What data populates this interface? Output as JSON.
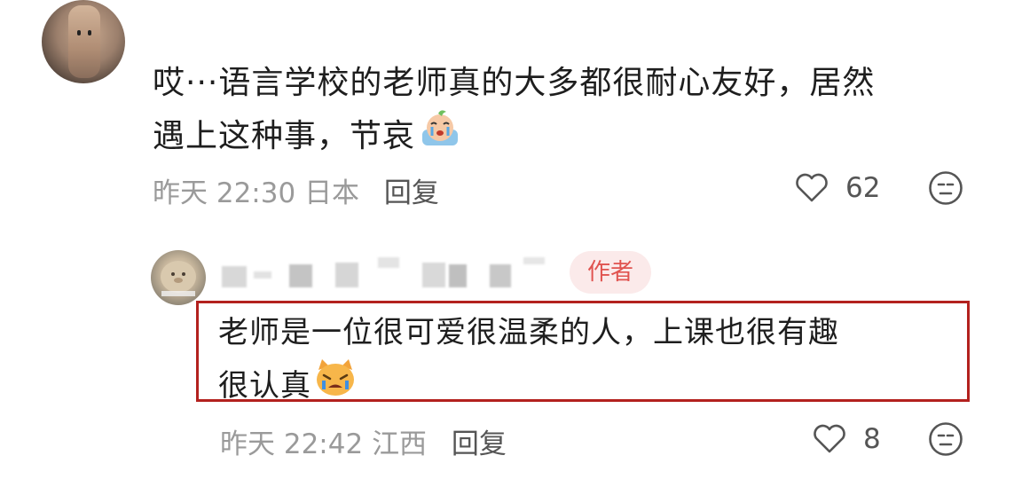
{
  "comment": {
    "line1": "哎···语言学校的老师真的大多都很耐心友好，居然",
    "line2": "遇上这种事，节哀",
    "emoji": "crying-emoji",
    "time": "昨天 22:30",
    "location": "日本",
    "reply_label": "回复",
    "likes": "62"
  },
  "reply": {
    "badge": "作者",
    "line1": "老师是一位很可爱很温柔的人，上课也很有趣",
    "line2": "很认真",
    "emoji": "crying-cat-emoji",
    "time": "昨天 22:42",
    "location": "江西",
    "reply_label": "回复",
    "likes": "8"
  },
  "colors": {
    "highlight_border": "#b3211e",
    "badge_text": "#e0534f",
    "badge_bg": "#fbeaea",
    "meta_text": "#9a9a9a"
  }
}
